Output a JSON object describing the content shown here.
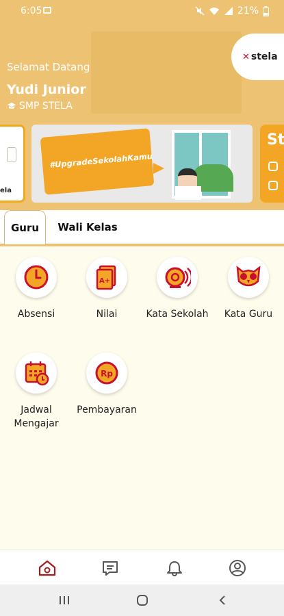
{
  "status_bar": {
    "time": "6:05",
    "battery": "21%"
  },
  "header": {
    "welcome": "Selamat Datang",
    "user_name": "Yudi Junior",
    "school": "SMP STELA"
  },
  "brand": {
    "logo_text": "stela",
    "logo_mark": "✕"
  },
  "carousel": {
    "left_text": "ela",
    "banner_hashtag": "#UpgradeSekolahKamu",
    "right_text": "St"
  },
  "tabs": [
    {
      "label": "Guru"
    },
    {
      "label": "Wali Kelas"
    }
  ],
  "menu": [
    {
      "label": "Absensi",
      "icon": "clock-icon"
    },
    {
      "label": "Nilai",
      "icon": "grade-document-icon"
    },
    {
      "label": "Kata Sekolah",
      "icon": "bell-icon"
    },
    {
      "label": "Kata Guru",
      "icon": "owl-icon"
    },
    {
      "label": "Jadwal Mengajar",
      "icon": "calendar-icon"
    },
    {
      "label": "Pembayaran",
      "icon": "rupiah-icon"
    }
  ],
  "icon_text": {
    "grade": "A+",
    "rupiah": "Rp"
  },
  "bottom_nav": [
    "home-icon",
    "chat-icon",
    "notification-icon",
    "profile-icon"
  ],
  "colors": {
    "accent": "#c8102e",
    "header": "#edc373",
    "orange": "#f3a526",
    "background": "#fefcec"
  }
}
